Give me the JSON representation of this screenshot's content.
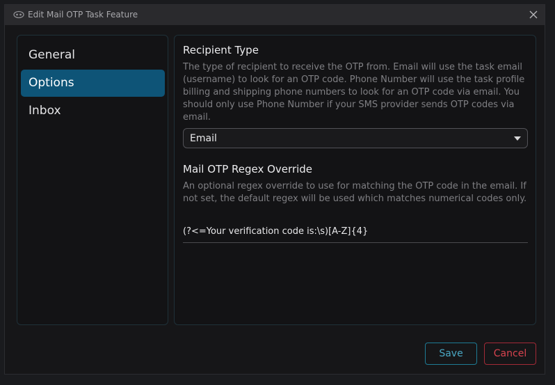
{
  "window": {
    "title": "Edit Mail OTP Task Feature"
  },
  "icons": {
    "app": "app-logo-icon",
    "close": "close-icon",
    "dropdown": "chevron-down-icon"
  },
  "sidebar": {
    "items": [
      {
        "label": "General",
        "active": false
      },
      {
        "label": "Options",
        "active": true
      },
      {
        "label": "Inbox",
        "active": false
      }
    ]
  },
  "recipient": {
    "title": "Recipient Type",
    "description": "The type of recipient to receive the OTP from. Email will use the task email (username) to look for an OTP code. Phone Number will use the task profile billing and shipping phone numbers to look for an OTP code via email. You should only use Phone Number if your SMS provider sends OTP codes via email.",
    "selected": "Email"
  },
  "regex": {
    "title": "Mail OTP Regex Override",
    "description": "An optional regex override to use for matching the OTP code in the email. If not set, the default regex will be used which matches numerical codes only.",
    "value": "(?<=Your verification code is:\\s)[A-Z]{4}"
  },
  "buttons": {
    "save": "Save",
    "cancel": "Cancel"
  },
  "colors": {
    "accent": "#0e5477",
    "save": "#4aa7c4",
    "cancel": "#d8434f"
  }
}
